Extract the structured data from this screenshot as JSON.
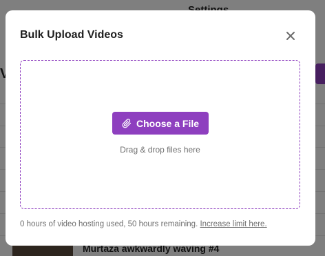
{
  "background": {
    "title": "Settings",
    "left_letter": "V",
    "row_title": "Murtaza awkwardly waving #4"
  },
  "modal": {
    "title": "Bulk Upload Videos",
    "close_icon": "close-icon",
    "choose_button_label": "Choose a File",
    "choose_button_icon": "paperclip-icon",
    "drag_hint": "Drag & drop files here",
    "usage_text": "0 hours of video hosting used, 50 hours remaining.",
    "increase_link": "Increase limit here.",
    "accent_color": "#8e3fbf"
  }
}
